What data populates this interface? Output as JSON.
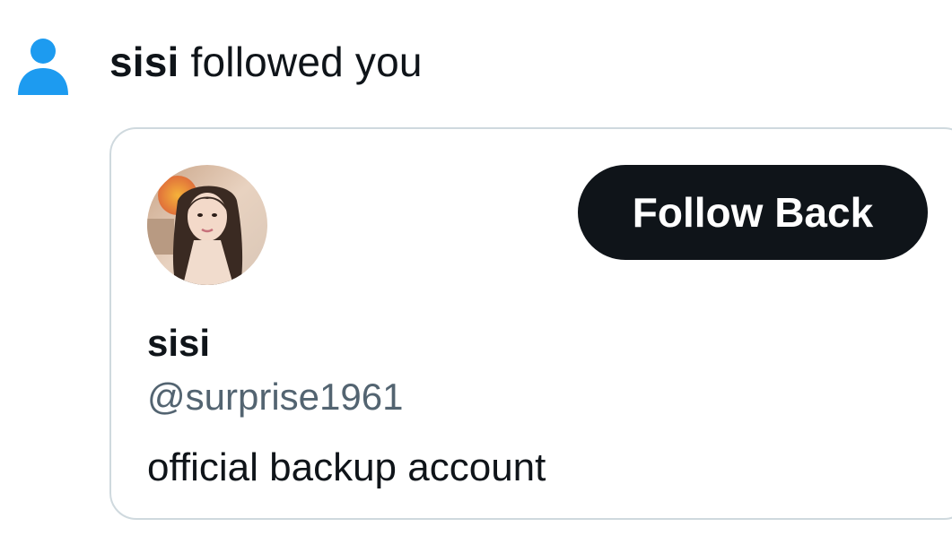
{
  "notification": {
    "actor_name": "sisi",
    "action_text": " followed you",
    "icon": "person-icon",
    "icon_color": "#1d9bf0"
  },
  "user_card": {
    "avatar": "avatar-photo",
    "follow_button_label": "Follow Back",
    "display_name": "sisi",
    "handle": "@surprise1961",
    "bio": "official backup account"
  }
}
